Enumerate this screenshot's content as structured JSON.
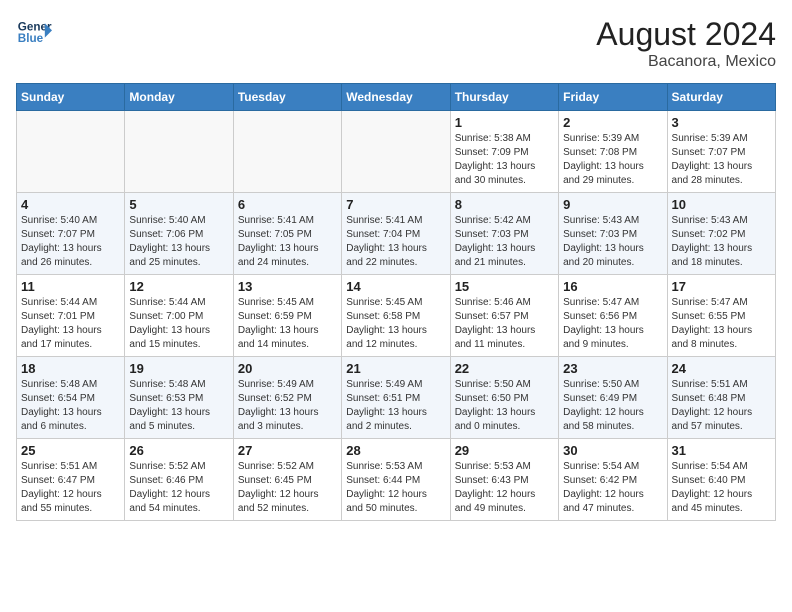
{
  "header": {
    "logo_line1": "General",
    "logo_line2": "Blue",
    "main_title": "August 2024",
    "subtitle": "Bacanora, Mexico"
  },
  "days_of_week": [
    "Sunday",
    "Monday",
    "Tuesday",
    "Wednesday",
    "Thursday",
    "Friday",
    "Saturday"
  ],
  "weeks": [
    [
      {
        "day": "",
        "info": ""
      },
      {
        "day": "",
        "info": ""
      },
      {
        "day": "",
        "info": ""
      },
      {
        "day": "",
        "info": ""
      },
      {
        "day": "1",
        "info": "Sunrise: 5:38 AM\nSunset: 7:09 PM\nDaylight: 13 hours\nand 30 minutes."
      },
      {
        "day": "2",
        "info": "Sunrise: 5:39 AM\nSunset: 7:08 PM\nDaylight: 13 hours\nand 29 minutes."
      },
      {
        "day": "3",
        "info": "Sunrise: 5:39 AM\nSunset: 7:07 PM\nDaylight: 13 hours\nand 28 minutes."
      }
    ],
    [
      {
        "day": "4",
        "info": "Sunrise: 5:40 AM\nSunset: 7:07 PM\nDaylight: 13 hours\nand 26 minutes."
      },
      {
        "day": "5",
        "info": "Sunrise: 5:40 AM\nSunset: 7:06 PM\nDaylight: 13 hours\nand 25 minutes."
      },
      {
        "day": "6",
        "info": "Sunrise: 5:41 AM\nSunset: 7:05 PM\nDaylight: 13 hours\nand 24 minutes."
      },
      {
        "day": "7",
        "info": "Sunrise: 5:41 AM\nSunset: 7:04 PM\nDaylight: 13 hours\nand 22 minutes."
      },
      {
        "day": "8",
        "info": "Sunrise: 5:42 AM\nSunset: 7:03 PM\nDaylight: 13 hours\nand 21 minutes."
      },
      {
        "day": "9",
        "info": "Sunrise: 5:43 AM\nSunset: 7:03 PM\nDaylight: 13 hours\nand 20 minutes."
      },
      {
        "day": "10",
        "info": "Sunrise: 5:43 AM\nSunset: 7:02 PM\nDaylight: 13 hours\nand 18 minutes."
      }
    ],
    [
      {
        "day": "11",
        "info": "Sunrise: 5:44 AM\nSunset: 7:01 PM\nDaylight: 13 hours\nand 17 minutes."
      },
      {
        "day": "12",
        "info": "Sunrise: 5:44 AM\nSunset: 7:00 PM\nDaylight: 13 hours\nand 15 minutes."
      },
      {
        "day": "13",
        "info": "Sunrise: 5:45 AM\nSunset: 6:59 PM\nDaylight: 13 hours\nand 14 minutes."
      },
      {
        "day": "14",
        "info": "Sunrise: 5:45 AM\nSunset: 6:58 PM\nDaylight: 13 hours\nand 12 minutes."
      },
      {
        "day": "15",
        "info": "Sunrise: 5:46 AM\nSunset: 6:57 PM\nDaylight: 13 hours\nand 11 minutes."
      },
      {
        "day": "16",
        "info": "Sunrise: 5:47 AM\nSunset: 6:56 PM\nDaylight: 13 hours\nand 9 minutes."
      },
      {
        "day": "17",
        "info": "Sunrise: 5:47 AM\nSunset: 6:55 PM\nDaylight: 13 hours\nand 8 minutes."
      }
    ],
    [
      {
        "day": "18",
        "info": "Sunrise: 5:48 AM\nSunset: 6:54 PM\nDaylight: 13 hours\nand 6 minutes."
      },
      {
        "day": "19",
        "info": "Sunrise: 5:48 AM\nSunset: 6:53 PM\nDaylight: 13 hours\nand 5 minutes."
      },
      {
        "day": "20",
        "info": "Sunrise: 5:49 AM\nSunset: 6:52 PM\nDaylight: 13 hours\nand 3 minutes."
      },
      {
        "day": "21",
        "info": "Sunrise: 5:49 AM\nSunset: 6:51 PM\nDaylight: 13 hours\nand 2 minutes."
      },
      {
        "day": "22",
        "info": "Sunrise: 5:50 AM\nSunset: 6:50 PM\nDaylight: 13 hours\nand 0 minutes."
      },
      {
        "day": "23",
        "info": "Sunrise: 5:50 AM\nSunset: 6:49 PM\nDaylight: 12 hours\nand 58 minutes."
      },
      {
        "day": "24",
        "info": "Sunrise: 5:51 AM\nSunset: 6:48 PM\nDaylight: 12 hours\nand 57 minutes."
      }
    ],
    [
      {
        "day": "25",
        "info": "Sunrise: 5:51 AM\nSunset: 6:47 PM\nDaylight: 12 hours\nand 55 minutes."
      },
      {
        "day": "26",
        "info": "Sunrise: 5:52 AM\nSunset: 6:46 PM\nDaylight: 12 hours\nand 54 minutes."
      },
      {
        "day": "27",
        "info": "Sunrise: 5:52 AM\nSunset: 6:45 PM\nDaylight: 12 hours\nand 52 minutes."
      },
      {
        "day": "28",
        "info": "Sunrise: 5:53 AM\nSunset: 6:44 PM\nDaylight: 12 hours\nand 50 minutes."
      },
      {
        "day": "29",
        "info": "Sunrise: 5:53 AM\nSunset: 6:43 PM\nDaylight: 12 hours\nand 49 minutes."
      },
      {
        "day": "30",
        "info": "Sunrise: 5:54 AM\nSunset: 6:42 PM\nDaylight: 12 hours\nand 47 minutes."
      },
      {
        "day": "31",
        "info": "Sunrise: 5:54 AM\nSunset: 6:40 PM\nDaylight: 12 hours\nand 45 minutes."
      }
    ]
  ]
}
